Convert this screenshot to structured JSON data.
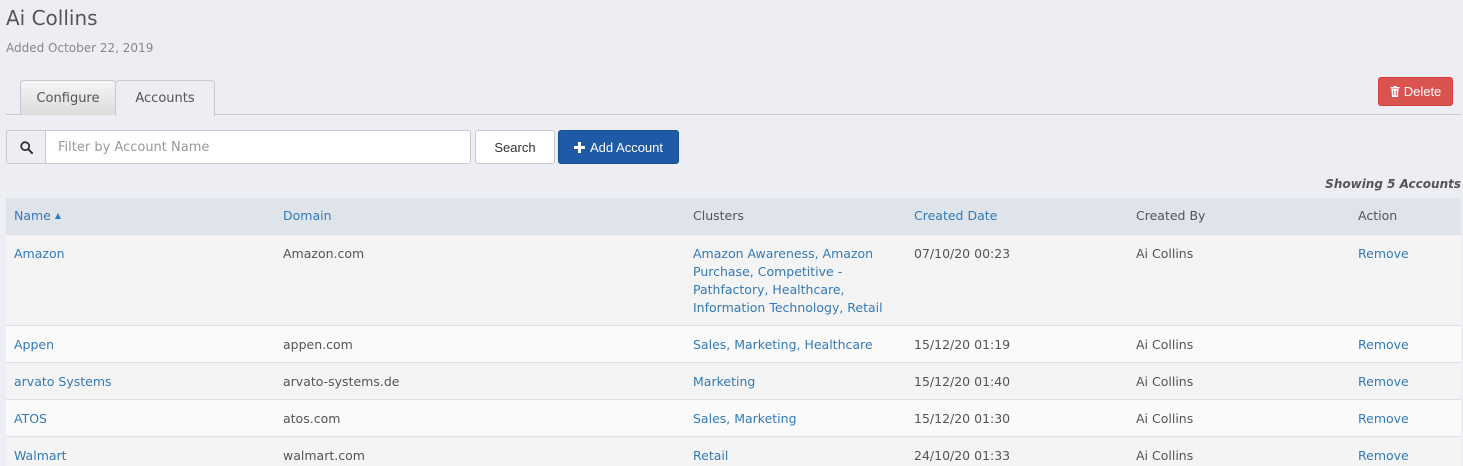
{
  "header": {
    "title": "Ai Collins",
    "added": "Added October 22, 2019"
  },
  "tabs": [
    {
      "label": "Configure",
      "active": false
    },
    {
      "label": "Accounts",
      "active": true
    }
  ],
  "actions": {
    "delete_label": "Delete",
    "delete_icon": "trash-icon",
    "search_placeholder": "Filter by Account Name",
    "search_value": "",
    "search_label": "Search",
    "add_label": "Add Account",
    "add_icon": "plus-icon"
  },
  "showing": "Showing 5 Accounts",
  "table": {
    "columns": {
      "name": "Name",
      "domain": "Domain",
      "clusters": "Clusters",
      "created_date": "Created Date",
      "created_by": "Created By",
      "action": "Action"
    },
    "sort_indicator": "▲",
    "rows": [
      {
        "name": "Amazon",
        "domain": "Amazon.com",
        "clusters": "Amazon Awareness, Amazon Purchase, Competitive - Pathfactory, Healthcare, Information Technology, Retail",
        "created_date": "07/10/20 00:23",
        "created_by": "Ai Collins",
        "action": "Remove"
      },
      {
        "name": "Appen",
        "domain": "appen.com",
        "clusters": "Sales, Marketing, Healthcare",
        "created_date": "15/12/20 01:19",
        "created_by": "Ai Collins",
        "action": "Remove"
      },
      {
        "name": "arvato Systems",
        "domain": "arvato-systems.de",
        "clusters": "Marketing",
        "created_date": "15/12/20 01:40",
        "created_by": "Ai Collins",
        "action": "Remove"
      },
      {
        "name": "ATOS",
        "domain": "atos.com",
        "clusters": "Sales, Marketing",
        "created_date": "15/12/20 01:30",
        "created_by": "Ai Collins",
        "action": "Remove"
      },
      {
        "name": "Walmart",
        "domain": "walmart.com",
        "clusters": "Retail",
        "created_date": "24/10/20 01:33",
        "created_by": "Ai Collins",
        "action": "Remove"
      }
    ]
  },
  "colors": {
    "link": "#337ab7",
    "primary": "#1f5aa6",
    "danger": "#d9534f",
    "background": "#eceef3"
  }
}
